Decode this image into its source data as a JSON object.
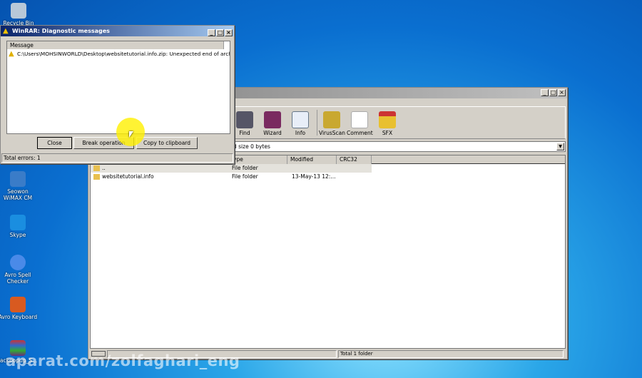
{
  "desktop": {
    "icons": [
      {
        "label": "Recycle Bin",
        "color": "#9ab"
      },
      {
        "label": "Seowon WiMAX CM",
        "color": "#3a7cc8"
      },
      {
        "label": "Skype",
        "color": "#1a8ee0"
      },
      {
        "label": "Avro Spell Checker",
        "color": "#4a8ae8"
      },
      {
        "label": "Avro Keyboard",
        "color": "#d85a20"
      },
      {
        "label": "Jackpopup_S...",
        "color": "#6a2a80"
      }
    ]
  },
  "dialog": {
    "title": "WinRAR: Diagnostic messages",
    "column": "Message",
    "message": "C:\\Users\\MOHSINWORLD\\Desktop\\websitetutorial.info.zip: Unexpected end of archive",
    "buttons": {
      "close": "Close",
      "break": "Break operation",
      "copy": "Copy to clipboard"
    },
    "status": "Total errors: 1"
  },
  "main": {
    "toolbar": [
      "Find",
      "Wizard",
      "Info",
      "VirusScan",
      "Comment",
      "SFX"
    ],
    "address": "d size 0 bytes",
    "columns": [
      "ype",
      "Modified",
      "CRC32"
    ],
    "rows": [
      {
        "name": "..",
        "type": "File folder",
        "modified": ""
      },
      {
        "name": "websitetutorial.info",
        "type": "File folder",
        "modified": "13-May-13 12:..."
      }
    ],
    "status": "Total 1 folder"
  },
  "watermark": "aparat.com/zolfaghari_eng"
}
